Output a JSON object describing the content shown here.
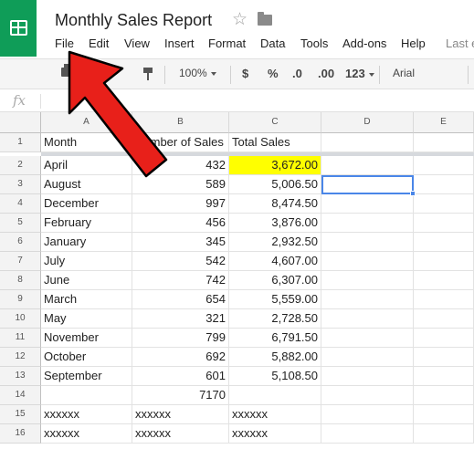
{
  "document": {
    "title": "Monthly Sales Report"
  },
  "menu": [
    "File",
    "Edit",
    "View",
    "Insert",
    "Format",
    "Data",
    "Tools",
    "Add-ons",
    "Help",
    "Last e"
  ],
  "toolbar": {
    "zoom": "100%",
    "currency": "$",
    "percent": "%",
    "decrease_decimal": ".0",
    "increase_decimal": ".00",
    "more_formats": "123",
    "font": "Arial"
  },
  "formula_bar": {
    "fx_label": "fx",
    "value": ""
  },
  "columns": [
    "A",
    "B",
    "C",
    "D",
    "E"
  ],
  "rows": [
    {
      "num": "1",
      "a": "Month",
      "b": "Number of Sales",
      "c": "Total Sales"
    },
    {
      "num": "2",
      "a": "April",
      "b": "432",
      "c": "3,672.00"
    },
    {
      "num": "3",
      "a": "August",
      "b": "589",
      "c": "5,006.50"
    },
    {
      "num": "4",
      "a": "December",
      "b": "997",
      "c": "8,474.50"
    },
    {
      "num": "5",
      "a": "February",
      "b": "456",
      "c": "3,876.00"
    },
    {
      "num": "6",
      "a": "January",
      "b": "345",
      "c": "2,932.50"
    },
    {
      "num": "7",
      "a": "July",
      "b": "542",
      "c": "4,607.00"
    },
    {
      "num": "8",
      "a": "June",
      "b": "742",
      "c": "6,307.00"
    },
    {
      "num": "9",
      "a": "March",
      "b": "654",
      "c": "5,559.00"
    },
    {
      "num": "10",
      "a": "May",
      "b": "321",
      "c": "2,728.50"
    },
    {
      "num": "11",
      "a": "November",
      "b": "799",
      "c": "6,791.50"
    },
    {
      "num": "12",
      "a": "October",
      "b": "692",
      "c": "5,882.00"
    },
    {
      "num": "13",
      "a": "September",
      "b": "601",
      "c": "5,108.50"
    },
    {
      "num": "14",
      "a": "",
      "b": "7170",
      "c": ""
    },
    {
      "num": "15",
      "a": "xxxxxx",
      "b": "xxxxxx",
      "c": "xxxxxx"
    },
    {
      "num": "16",
      "a": "xxxxxx",
      "b": "xxxxxx",
      "c": "xxxxxx"
    }
  ],
  "colors": {
    "brand": "#0f9d58",
    "highlight": "#ffff00",
    "selection": "#4a86e8",
    "arrow": "#e8201a"
  },
  "annotation": {
    "type": "red-arrow",
    "points_to": "File"
  }
}
